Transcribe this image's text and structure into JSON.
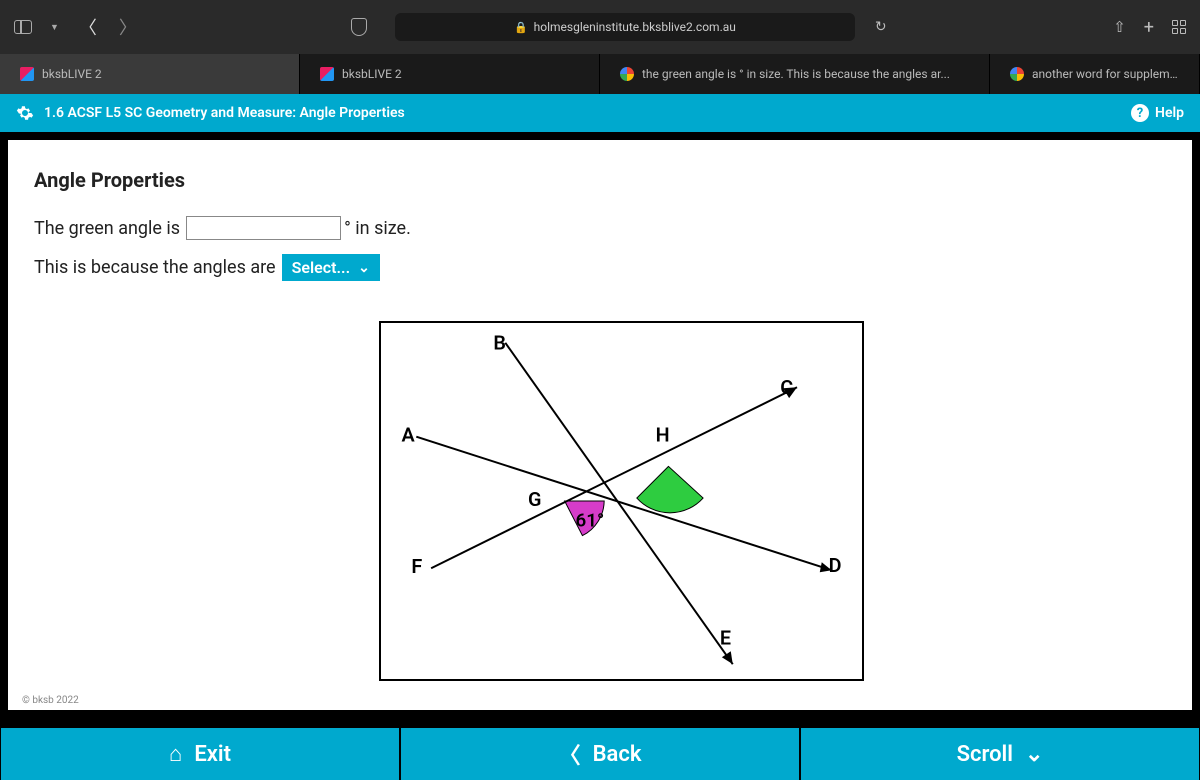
{
  "url": "holmesgleninstitute.bksblive2.com.au",
  "tabs": [
    {
      "label": "bksbLIVE 2",
      "fav": "b",
      "active": true
    },
    {
      "label": "bksbLIVE 2",
      "fav": "b",
      "active": false
    },
    {
      "label": "the green angle is ° in size. This is because the angles ar...",
      "fav": "g",
      "active": false
    },
    {
      "label": "another word for supplementary angles - Google Search",
      "fav": "g",
      "active": false
    }
  ],
  "header": {
    "title": "1.6 ACSF L5 SC Geometry and Measure: Angle Properties",
    "help": "Help"
  },
  "page": {
    "title": "Angle Properties",
    "line1_a": "The green angle is",
    "line1_b": "° in size.",
    "input_value": "",
    "line2_a": "This is because the angles are",
    "select_label": "Select...",
    "figure": {
      "A": "A",
      "B": "B",
      "C": "C",
      "D": "D",
      "E": "E",
      "F": "F",
      "G": "G",
      "H": "H",
      "angle_label": "61°"
    }
  },
  "copyright": "© bksb 2022",
  "footer": {
    "exit": "Exit",
    "back": "Back",
    "scroll": "Scroll"
  }
}
